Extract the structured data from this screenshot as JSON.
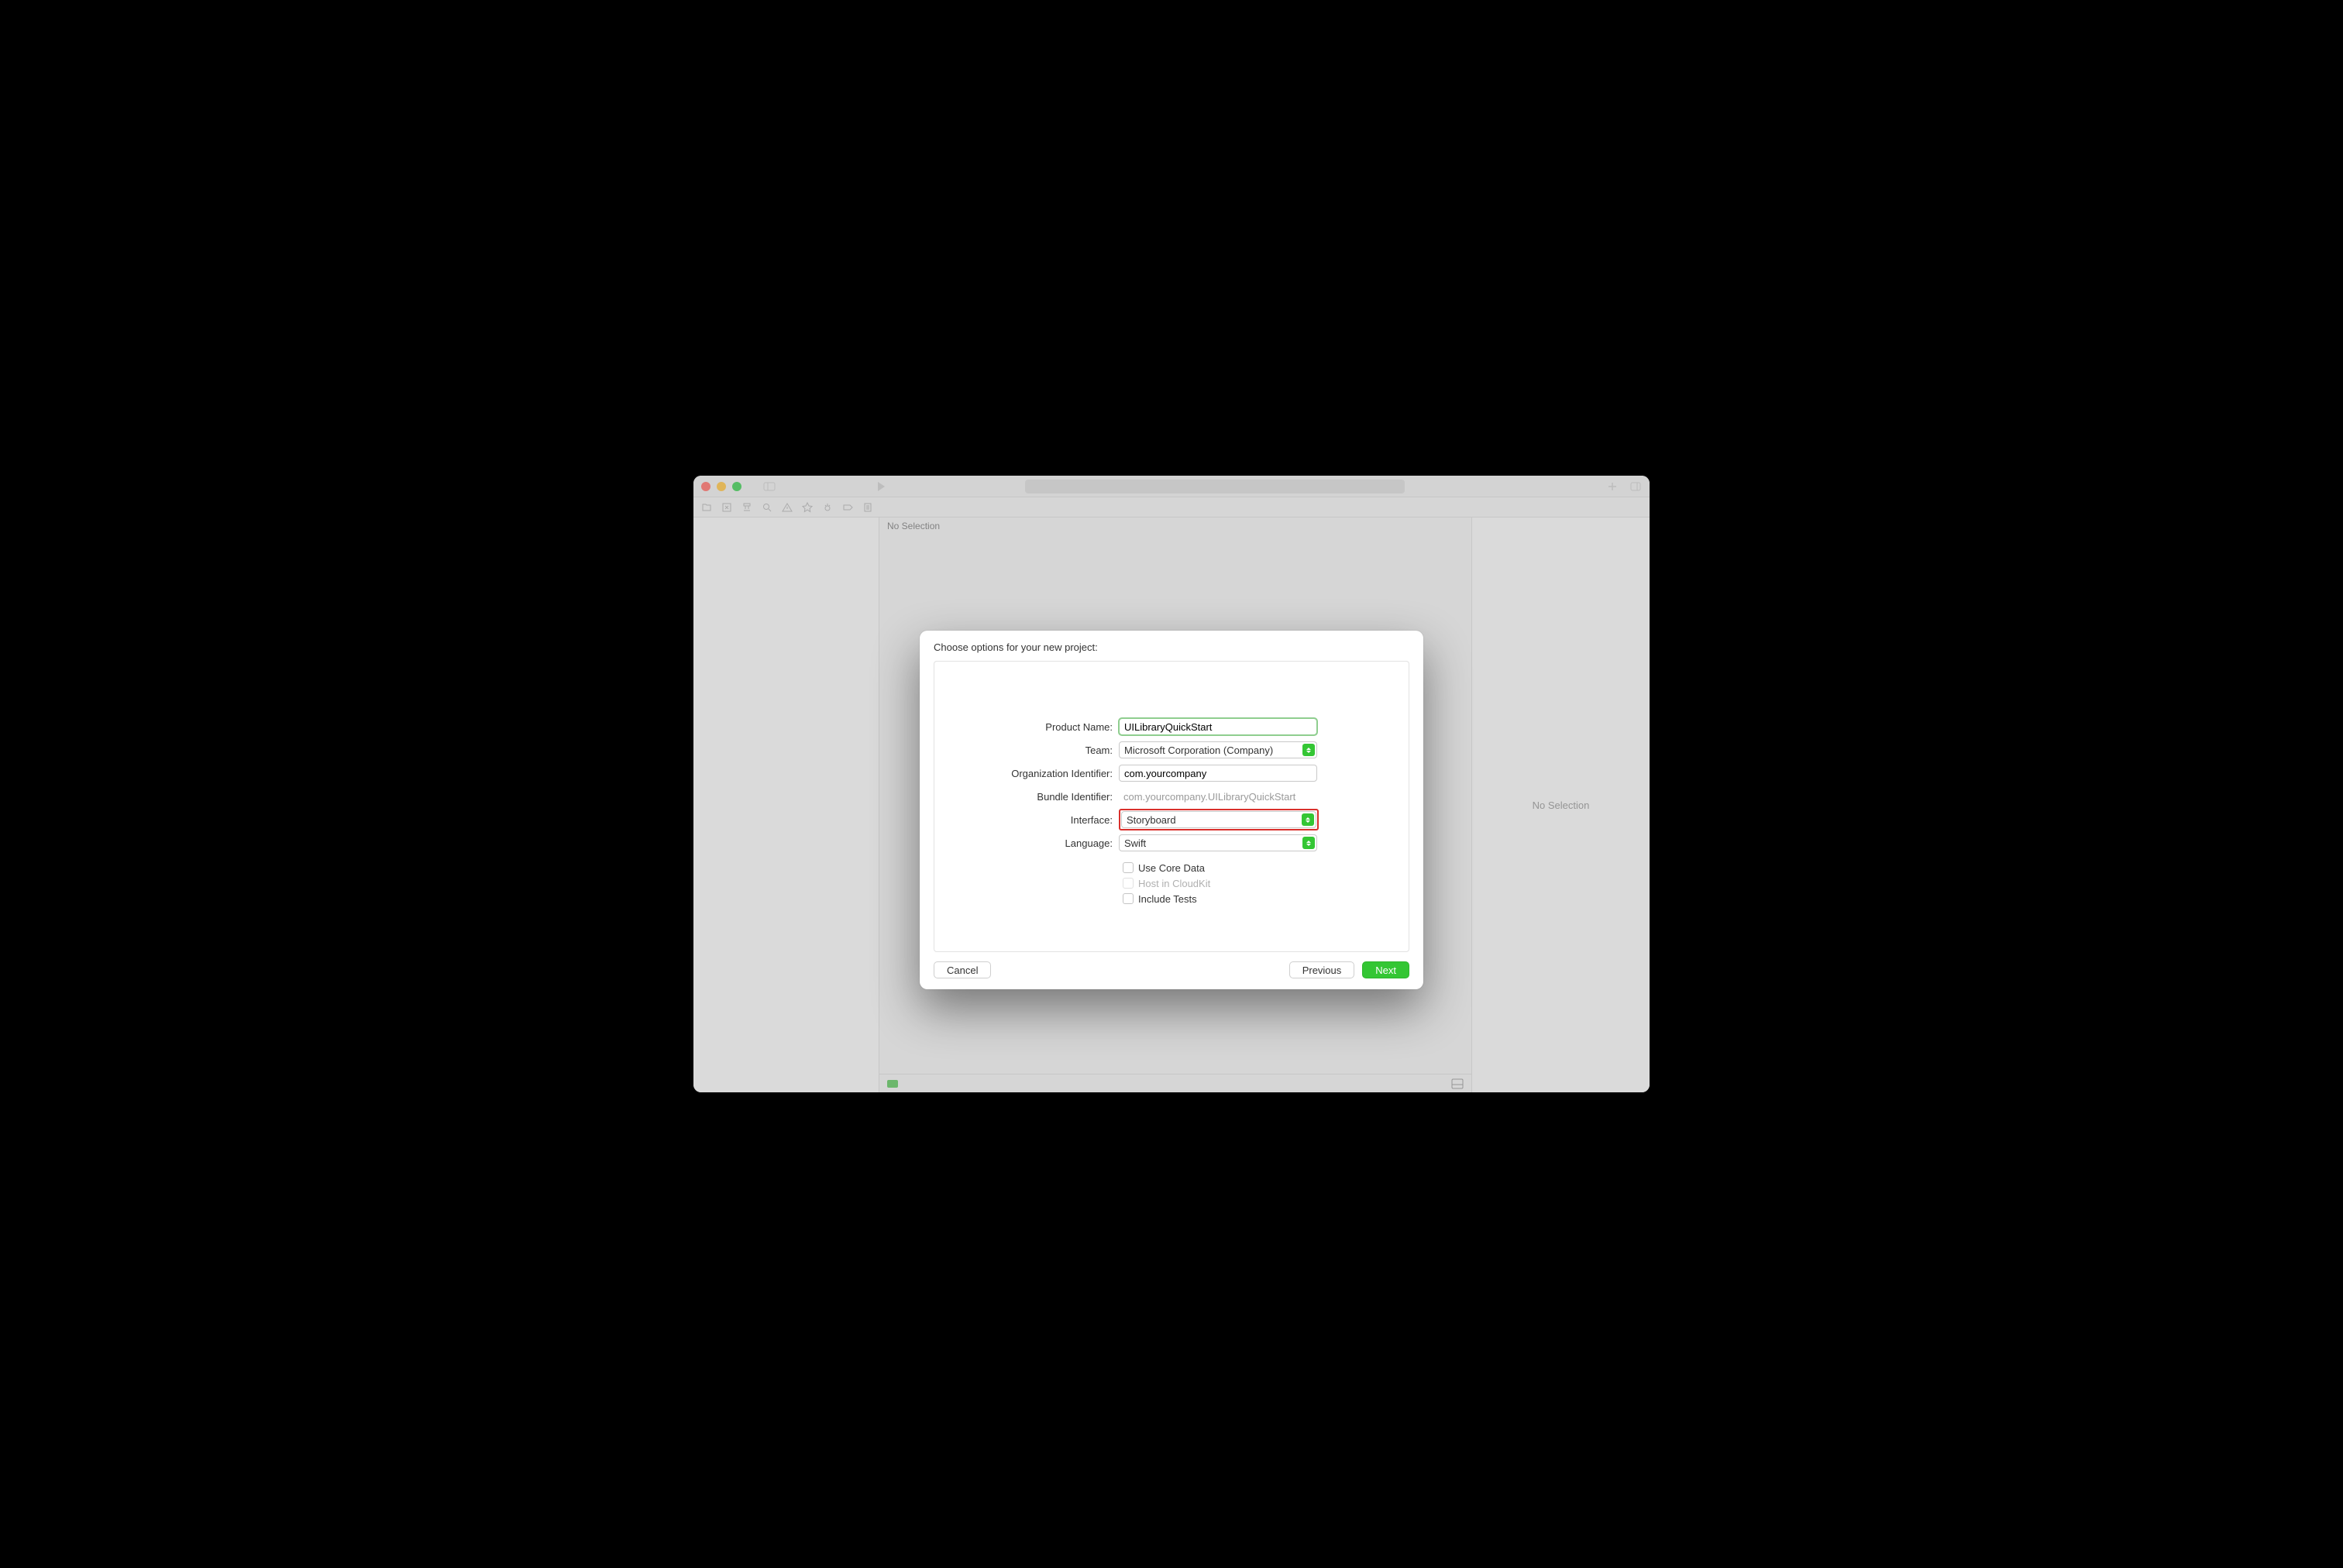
{
  "breadcrumb": "No Selection",
  "inspector": {
    "placeholder": "No Selection"
  },
  "sheet": {
    "title": "Choose options for your new project:",
    "labels": {
      "product_name": "Product Name:",
      "team": "Team:",
      "org_id": "Organization Identifier:",
      "bundle_id": "Bundle Identifier:",
      "interface": "Interface:",
      "language": "Language:"
    },
    "values": {
      "product_name": "UILibraryQuickStart",
      "team": "Microsoft Corporation (Company)",
      "org_id": "com.yourcompany",
      "bundle_id": "com.yourcompany.UILibraryQuickStart",
      "interface": "Storyboard",
      "language": "Swift"
    },
    "checkboxes": {
      "core_data": "Use Core Data",
      "cloudkit": "Host in CloudKit",
      "tests": "Include Tests"
    },
    "buttons": {
      "cancel": "Cancel",
      "previous": "Previous",
      "next": "Next"
    }
  }
}
